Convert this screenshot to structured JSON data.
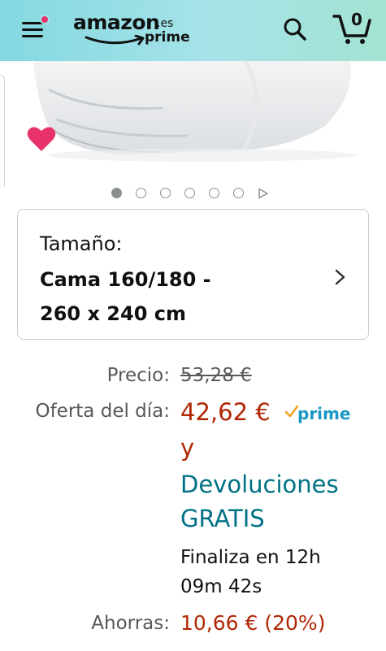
{
  "header": {
    "logo_word": "amazon",
    "logo_tld": ".es",
    "logo_sub": "prime",
    "cart_count": "0",
    "icons": [
      "menu-icon",
      "search-icon",
      "cart-icon"
    ],
    "colors": {
      "notification_dot": "#e8326a",
      "gradient_start": "#84d8e0",
      "gradient_end": "#a3e3d2"
    }
  },
  "gallery": {
    "wishlist_icon": "heart-icon",
    "heart_color": "#e8326a",
    "page_count": 6,
    "active_page": 1
  },
  "size_selector": {
    "label": "Tamaño:",
    "value_line1": "Cama 160/180 -",
    "value_line2": "260 x 240 cm"
  },
  "pricing": {
    "price_label": "Precio:",
    "old_price": "53,28 €",
    "deal_label": "Oferta del día:",
    "deal_price": "42,62 €",
    "prime_label": "prime",
    "conjunction": "y",
    "free_returns_line1": "Devoluciones",
    "free_returns_line2": "GRATIS",
    "ends_line1": "Finaliza en 12h",
    "ends_line2": "09m 42s",
    "savings_label": "Ahorras:",
    "savings_value": "10,66 € (20%)",
    "colors": {
      "deal": "#b12704",
      "link": "#007185",
      "prime": "#1a98c4"
    }
  }
}
